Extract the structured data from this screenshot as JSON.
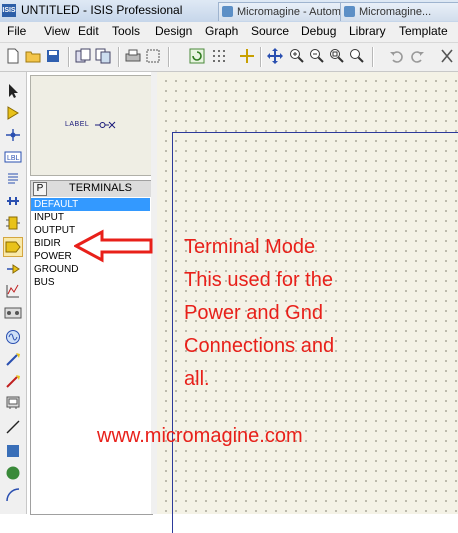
{
  "app": {
    "icon_text": "ISIS",
    "title": "UNTITLED - ISIS Professional"
  },
  "browser_tabs": [
    {
      "label": "Micromagine - Automatio..."
    },
    {
      "label": "Micromagine..."
    }
  ],
  "menu": {
    "items": [
      "File",
      "View",
      "Edit",
      "Tools",
      "Design",
      "Graph",
      "Source",
      "Debug",
      "Library",
      "Template"
    ]
  },
  "toolbar": {
    "buttons": [
      "new-file-icon",
      "open-folder-icon",
      "save-icon",
      "import-icon",
      "export-icon",
      "print-icon",
      "print-area-icon",
      "refresh-icon",
      "grid-icon",
      "origin-icon",
      "pan-icon",
      "zoom-in-icon",
      "zoom-out-icon",
      "zoom-all-icon",
      "zoom-area-icon",
      "undo-icon",
      "redo-icon",
      "cut-icon"
    ]
  },
  "left_tools": [
    "selection-mode-icon",
    "component-mode-icon",
    "junction-icon",
    "wire-label-icon",
    "text-script-icon",
    "buses-icon",
    "subcircuit-icon",
    "terminal-mode-icon",
    "device-pins-icon",
    "graph-mode-icon",
    "tape-recorder-icon",
    "generator-icon",
    "voltage-probe-icon",
    "current-probe-icon",
    "virtual-instrument-icon",
    "line-icon",
    "box-icon",
    "circle-icon",
    "arc-icon"
  ],
  "preview": {
    "label": "LABEL"
  },
  "selector": {
    "p_button": "P",
    "title": "TERMINALS"
  },
  "terminals": [
    "DEFAULT",
    "INPUT",
    "OUTPUT",
    "BIDIR",
    "POWER",
    "GROUND",
    "BUS"
  ],
  "selected_terminal": "DEFAULT",
  "annotation": {
    "lines": [
      "Terminal Mode",
      "This used for the",
      "Power and Gnd",
      "Connections and",
      "all."
    ],
    "website": "www.micromagine.com",
    "color": "#e8201a"
  },
  "colors": {
    "canvas_bg": "#f4f2e6",
    "sheet_border": "#2d3a9a",
    "selection": "#3399ff",
    "annotation": "#e8201a"
  }
}
